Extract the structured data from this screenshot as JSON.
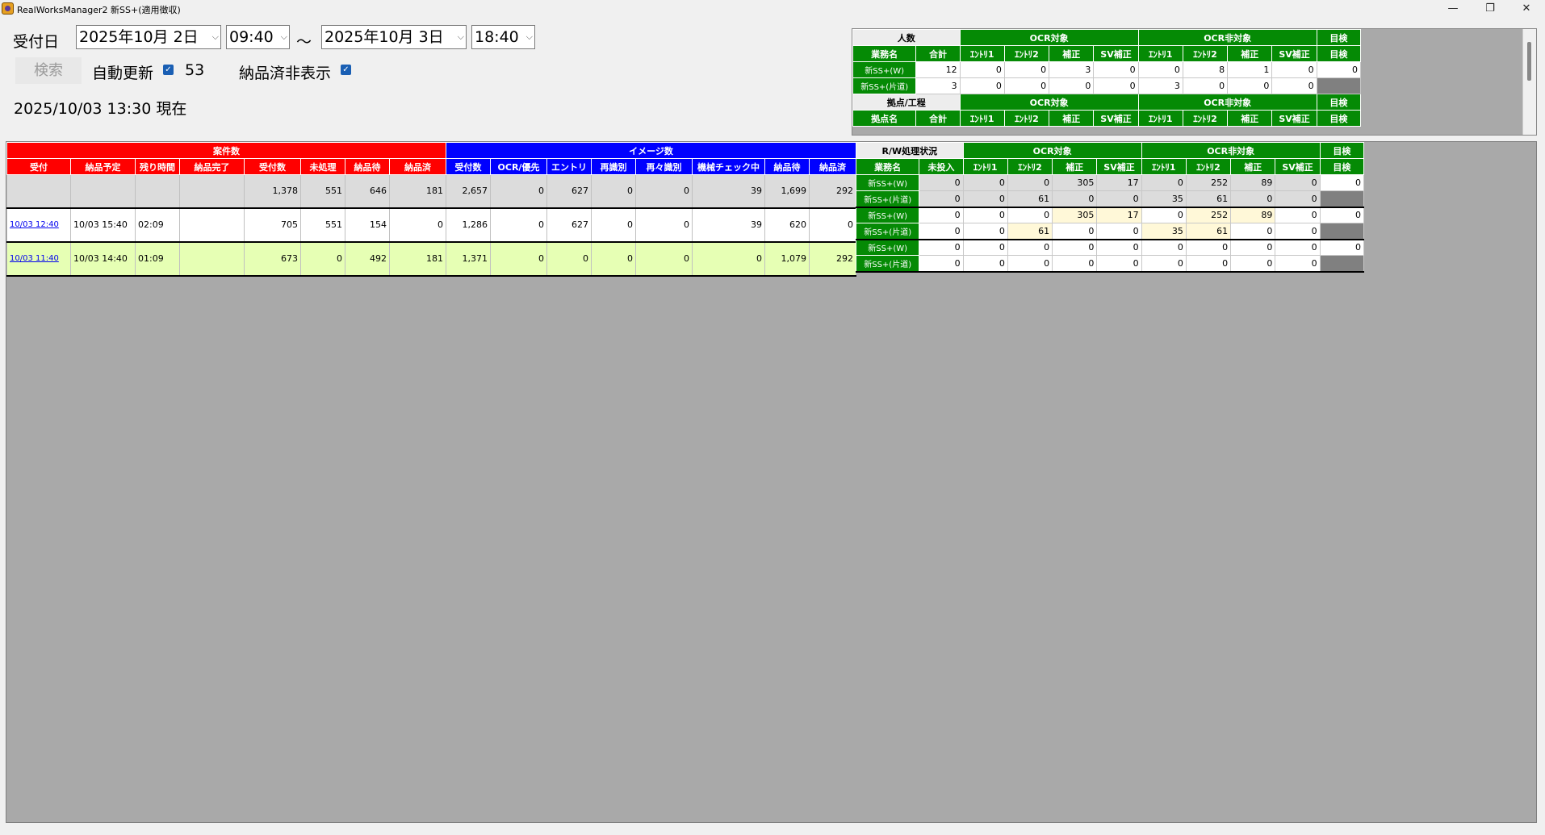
{
  "window": {
    "title": "RealWorksManager2 新SS+(適用徴収)",
    "min": "—",
    "max": "❐",
    "close": "✕"
  },
  "filter": {
    "label": "受付日",
    "from_date": "2025年10月  2日",
    "from_time": "09:40",
    "tilde": "～",
    "to_date": "2025年10月  3日",
    "to_time": "18:40",
    "search_button": "検索",
    "auto_update_label": "自動更新",
    "auto_update_checked": true,
    "auto_update_interval": "53",
    "hide_delivered_label": "納品済非表示",
    "hide_delivered_checked": true,
    "as_of": "2025/10/03 13:30 現在"
  },
  "staff_panel": {
    "title": "人数",
    "ocr_group": "OCR対象",
    "nonocr_group": "OCR非対象",
    "inspect": "目検",
    "columns": [
      "業務名",
      "合計",
      "ｴﾝﾄﾘ1",
      "ｴﾝﾄﾘ2",
      "補正",
      "SV補正",
      "ｴﾝﾄﾘ1",
      "ｴﾝﾄﾘ2",
      "補正",
      "SV補正",
      "目検"
    ],
    "rows": [
      {
        "name": "新SS+(W)",
        "values": [
          "12",
          "0",
          "0",
          "3",
          "0",
          "0",
          "8",
          "1",
          "0",
          "0"
        ]
      },
      {
        "name": "新SS+(片道)",
        "values": [
          "3",
          "0",
          "0",
          "0",
          "0",
          "3",
          "0",
          "0",
          "0",
          ""
        ]
      }
    ],
    "site_title": "拠点/工程",
    "site_columns": [
      "拠点名",
      "合計",
      "ｴﾝﾄﾘ1",
      "ｴﾝﾄﾘ2",
      "補正",
      "SV補正",
      "ｴﾝﾄﾘ1",
      "ｴﾝﾄﾘ2",
      "補正",
      "SV補正",
      "目検"
    ]
  },
  "main_table": {
    "case_group": "案件数",
    "image_group": "イメージ数",
    "columns": [
      "受付",
      "納品予定",
      "残り時間",
      "納品完了",
      "受付数",
      "未処理",
      "納品待",
      "納品済",
      "受付数",
      "OCR/優先",
      "エントリ",
      "再識別",
      "再々識別",
      "機械チェック中",
      "納品待",
      "納品済"
    ],
    "rows": [
      {
        "cells": [
          "",
          "",
          "",
          "",
          "1,378",
          "551",
          "646",
          "181",
          "2,657",
          "0",
          "627",
          "0",
          "0",
          "39",
          "1,699",
          "292"
        ]
      },
      {
        "cells": [
          "10/03 12:40",
          "10/03 15:40",
          "02:09",
          "",
          "705",
          "551",
          "154",
          "0",
          "1,286",
          "0",
          "627",
          "0",
          "0",
          "39",
          "620",
          "0"
        ]
      },
      {
        "cells": [
          "10/03 11:40",
          "10/03 14:40",
          "01:09",
          "",
          "673",
          "0",
          "492",
          "181",
          "1,371",
          "0",
          "0",
          "0",
          "0",
          "0",
          "1,079",
          "292"
        ]
      }
    ]
  },
  "rw_table": {
    "title": "R/W処理状況",
    "ocr_group": "OCR対象",
    "nonocr_group": "OCR非対象",
    "inspect": "目検",
    "columns": [
      "業務名",
      "未投入",
      "ｴﾝﾄﾘ1",
      "ｴﾝﾄﾘ2",
      "補正",
      "SV補正",
      "ｴﾝﾄﾘ1",
      "ｴﾝﾄﾘ2",
      "補正",
      "SV補正",
      "目検"
    ],
    "rows": [
      {
        "name": "新SS+(W)",
        "values": [
          "0",
          "0",
          "0",
          "305",
          "17",
          "0",
          "252",
          "89",
          "0",
          "0"
        ]
      },
      {
        "name": "新SS+(片道)",
        "values": [
          "0",
          "0",
          "61",
          "0",
          "0",
          "35",
          "61",
          "0",
          "0",
          ""
        ]
      },
      {
        "name": "新SS+(W)",
        "values": [
          "0",
          "0",
          "0",
          "305",
          "17",
          "0",
          "252",
          "89",
          "0",
          "0"
        ]
      },
      {
        "name": "新SS+(片道)",
        "values": [
          "0",
          "0",
          "61",
          "0",
          "0",
          "35",
          "61",
          "0",
          "0",
          ""
        ]
      },
      {
        "name": "新SS+(W)",
        "values": [
          "0",
          "0",
          "0",
          "0",
          "0",
          "0",
          "0",
          "0",
          "0",
          "0"
        ]
      },
      {
        "name": "新SS+(片道)",
        "values": [
          "0",
          "0",
          "0",
          "0",
          "0",
          "0",
          "0",
          "0",
          "0",
          ""
        ]
      }
    ]
  },
  "colors": {
    "case_header": "#ff0000",
    "image_header": "#0000ff",
    "rw_header": "#058a05",
    "highlight_row": "#e6ffb4",
    "summary_row": "#dcdcdc",
    "background": "#a9a9a9"
  }
}
